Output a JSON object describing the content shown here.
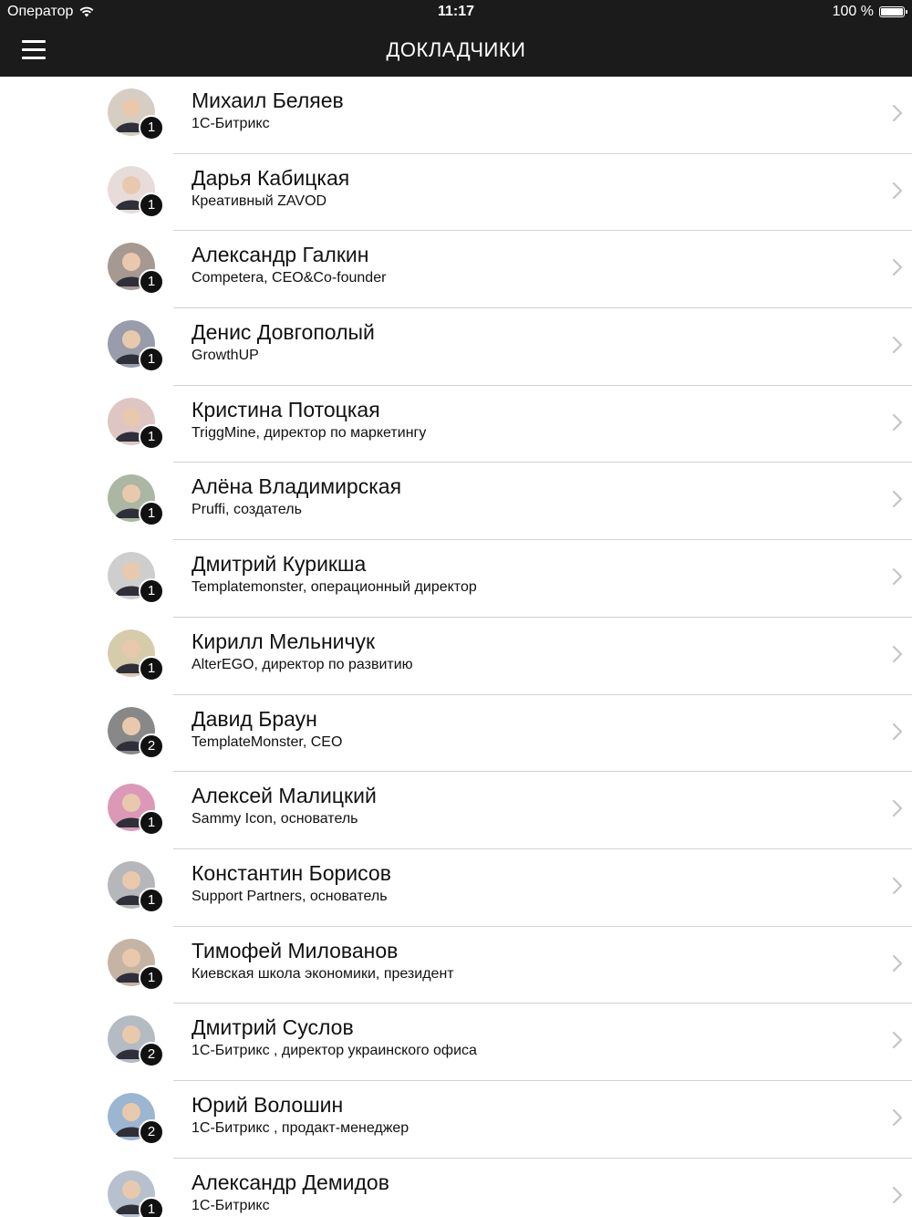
{
  "status_bar": {
    "carrier": "Оператор",
    "time": "11:17",
    "battery": "100 %"
  },
  "nav": {
    "title": "ДОКЛАДЧИКИ"
  },
  "speakers": [
    {
      "name": "Михаил Беляев",
      "company": "1С-Битрикс",
      "count": "1",
      "avatar_color": "#c9b8a6"
    },
    {
      "name": "Дарья Кабицкая",
      "company": "Креативный ZAVOD",
      "count": "1",
      "avatar_color": "#e8d4cf"
    },
    {
      "name": "Александр Галкин",
      "company": "Competera, CEO&Co-founder",
      "count": "1",
      "avatar_color": "#6f5a4a"
    },
    {
      "name": "Денис Довгополый",
      "company": "GrowthUP",
      "count": "1",
      "avatar_color": "#5a5f7a"
    },
    {
      "name": "Кристина Потоцкая",
      "company": "TriggMine, директор по маркетингу",
      "count": "1",
      "avatar_color": "#d9a9a6"
    },
    {
      "name": "Алёна Владимирская",
      "company": "Pruffi, создатель",
      "count": "1",
      "avatar_color": "#7a8f6a"
    },
    {
      "name": "Дмитрий Курикша",
      "company": "Templatemonster, операционный директор",
      "count": "1",
      "avatar_color": "#b9b9b9"
    },
    {
      "name": "Кирилл Мельничук",
      "company": "AlterEGO, директор по развитию",
      "count": "1",
      "avatar_color": "#c9b77a"
    },
    {
      "name": "Давид Браун",
      "company": "TemplateMonster, CEO",
      "count": "2",
      "avatar_color": "#3a3a3a"
    },
    {
      "name": "Алексей Малицкий",
      "company": "Sammy Icon, основатель",
      "count": "1",
      "avatar_color": "#d35a8f"
    },
    {
      "name": "Константин Борисов",
      "company": "Support Partners, основатель",
      "count": "1",
      "avatar_color": "#8c8f96"
    },
    {
      "name": "Тимофей Милованов",
      "company": "Киевская школа экономики, президент",
      "count": "1",
      "avatar_color": "#a98a6e"
    },
    {
      "name": "Дмитрий Суслов",
      "company": "1С-Битрикс , директор украинского офиса",
      "count": "2",
      "avatar_color": "#8a98a6"
    },
    {
      "name": "Юрий Волошин",
      "company": "1С-Битрикс , продакт-менеджер",
      "count": "2",
      "avatar_color": "#5e8ec0"
    },
    {
      "name": "Александр Демидов",
      "company": "1С-Битрикс",
      "count": "1",
      "avatar_color": "#8fa3b8"
    }
  ]
}
